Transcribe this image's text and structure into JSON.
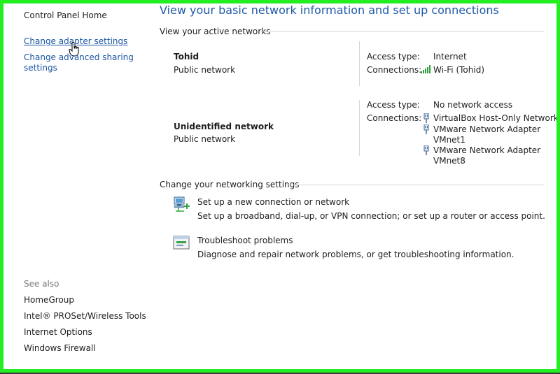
{
  "sidebar": {
    "home": "Control Panel Home",
    "items": [
      {
        "label": "Change adapter settings"
      },
      {
        "label_line1": "Change advanced sharing",
        "label_line2": "settings"
      }
    ],
    "see_also": {
      "heading": "See also",
      "links": [
        "HomeGroup",
        "Intel® PROSet/Wireless Tools",
        "Internet Options",
        "Windows Firewall"
      ]
    }
  },
  "main": {
    "title": "View your basic network information and set up connections",
    "active_networks_heading": "View your active networks",
    "networks": [
      {
        "name": "Tohid",
        "category": "Public network",
        "access_label": "Access type:",
        "access_value": "Internet",
        "connections_label": "Connections:",
        "connections": [
          {
            "text": "Wi-Fi (Tohid)",
            "icon": "wifi-signal-icon"
          }
        ]
      },
      {
        "name": "Unidentified network",
        "category": "Public network",
        "access_label": "Access type:",
        "access_value": "No network access",
        "connections_label": "Connections:",
        "connections": [
          {
            "text": "VirtualBox Host-Only Network",
            "icon": "ethernet-adapter-icon"
          },
          {
            "line1": "VMware Network Adapter",
            "line2": "VMnet1",
            "icon": "ethernet-adapter-icon"
          },
          {
            "line1": "VMware Network Adapter",
            "line2": "VMnet8",
            "icon": "ethernet-adapter-icon"
          }
        ]
      }
    ],
    "settings_heading": "Change your networking settings",
    "tasks": [
      {
        "link": "Set up a new connection or network",
        "desc": "Set up a broadband, dial-up, or VPN connection; or set up a router or access point.",
        "icon": "new-connection-icon"
      },
      {
        "link": "Troubleshoot problems",
        "desc": "Diagnose and repair network problems, or get troubleshooting information.",
        "icon": "troubleshoot-icon"
      }
    ]
  },
  "colors": {
    "frame_border": "#22ee22",
    "link": "#1a55a5",
    "title": "#1e5aa8"
  }
}
